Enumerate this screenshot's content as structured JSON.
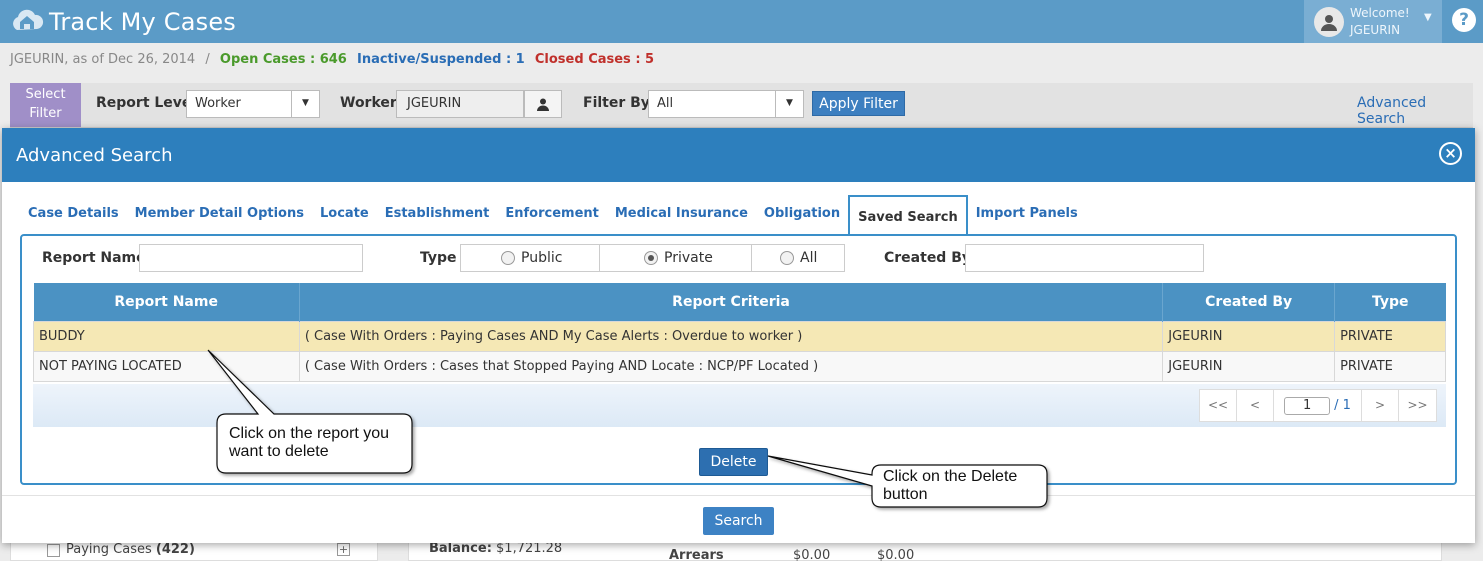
{
  "app": {
    "title": "Track My Cases",
    "help": "?"
  },
  "user": {
    "welcome": "Welcome!",
    "name": "JGEURIN"
  },
  "status": {
    "context": "JGEURIN, as of Dec 26, 2014",
    "separator": "/",
    "open": "Open Cases : 646",
    "inactive": "Inactive/Suspended : 1",
    "closed": "Closed Cases : 5"
  },
  "filterbar": {
    "select_filter": [
      "Select",
      "Filter"
    ],
    "report_level_label": "Report Level",
    "report_level_value": "Worker",
    "worker_label": "Worker",
    "worker_value": "JGEURIN",
    "filter_by_label": "Filter By",
    "filter_by_value": "All",
    "apply_label": "Apply Filter",
    "advanced_link": "Advanced Search"
  },
  "background": {
    "paying_cases_label": "Paying Cases",
    "paying_cases_count": "(422)",
    "balance_label": "Balance:",
    "balance_value": "$1,721.28",
    "arrears_label": "Arrears",
    "arrears_v1": "$0.00",
    "arrears_v2": "$0.00"
  },
  "modal": {
    "title": "Advanced Search",
    "close": "×",
    "tabs": [
      {
        "label": "Case Details"
      },
      {
        "label": "Member Detail Options"
      },
      {
        "label": "Locate"
      },
      {
        "label": "Establishment"
      },
      {
        "label": "Enforcement"
      },
      {
        "label": "Medical Insurance"
      },
      {
        "label": "Obligation"
      },
      {
        "label": "Saved Search"
      },
      {
        "label": "Import Panels"
      }
    ],
    "active_tab": "Saved Search",
    "form": {
      "report_name_label": "Report Name",
      "report_name_value": "",
      "type_label": "Type",
      "type_options": [
        "Public",
        "Private",
        "All"
      ],
      "type_selected": "Private",
      "created_by_label": "Created By",
      "created_by_value": ""
    },
    "grid": {
      "columns": [
        "Report Name",
        "Report Criteria",
        "Created By",
        "Type"
      ],
      "rows": [
        {
          "name": "BUDDY",
          "criteria": "( Case With Orders : Paying Cases AND My Case Alerts : Overdue to worker )",
          "created_by": "JGEURIN",
          "type": "PRIVATE",
          "selected": true
        },
        {
          "name": "NOT PAYING LOCATED",
          "criteria": "( Case With Orders : Cases that Stopped Paying AND Locate : NCP/PF Located )",
          "created_by": "JGEURIN",
          "type": "PRIVATE",
          "selected": false
        }
      ]
    },
    "pager": {
      "first": "<<",
      "prev": "<",
      "page": "1",
      "of": "/ 1",
      "next": ">",
      "last": ">>"
    },
    "delete_label": "Delete",
    "search_label": "Search"
  },
  "callouts": {
    "row": [
      "Click on the report you",
      "want to delete"
    ],
    "delete": [
      "Click on the Delete",
      "button"
    ]
  },
  "colors": {
    "header_bg": "#5b9bc7",
    "modal_header": "#2d7fbd",
    "grid_header": "#4b92c3",
    "selected_row": "#f5e8b5",
    "button": "#2d6fb0"
  }
}
